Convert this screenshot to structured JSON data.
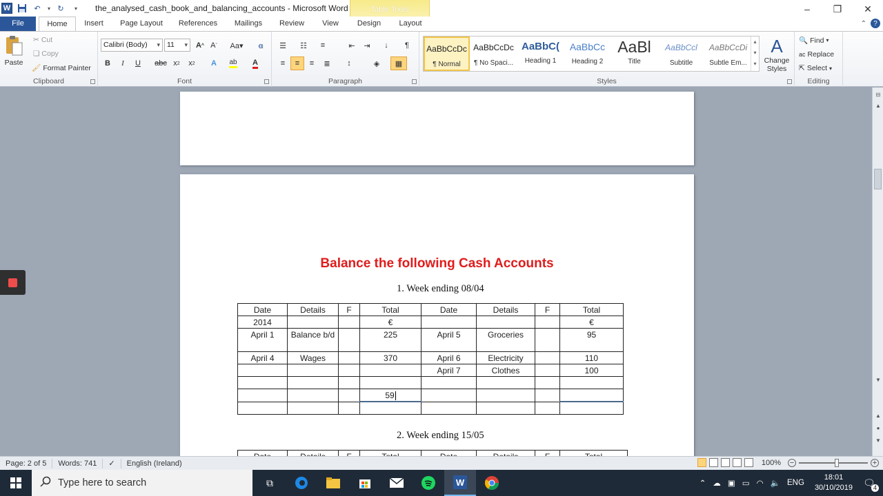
{
  "window": {
    "title": "the_analysed_cash_book_and_balancing_accounts  -  Microsoft Word",
    "context_tab_group": "Table Tools"
  },
  "tabs": [
    "File",
    "Home",
    "Insert",
    "Page Layout",
    "References",
    "Mailings",
    "Review",
    "View",
    "Design",
    "Layout"
  ],
  "ribbon": {
    "clipboard": {
      "label": "Clipboard",
      "paste": "Paste",
      "cut": "Cut",
      "copy": "Copy",
      "format_painter": "Format Painter"
    },
    "font": {
      "label": "Font",
      "font_name": "Calibri (Body)",
      "font_size": "11"
    },
    "paragraph": {
      "label": "Paragraph"
    },
    "styles": {
      "label": "Styles",
      "items": [
        {
          "preview": "AaBbCcDc",
          "name": "¶ Normal"
        },
        {
          "preview": "AaBbCcDc",
          "name": "¶ No Spaci..."
        },
        {
          "preview": "AaBbC(",
          "name": "Heading 1"
        },
        {
          "preview": "AaBbCc",
          "name": "Heading 2"
        },
        {
          "preview": "AaBl",
          "name": "Title"
        },
        {
          "preview": "AaBbCcl",
          "name": "Subtitle"
        },
        {
          "preview": "AaBbCcDi",
          "name": "Subtle Em..."
        }
      ],
      "change_styles": "Change Styles"
    },
    "editing": {
      "label": "Editing",
      "find": "Find",
      "replace": "Replace",
      "select": "Select"
    }
  },
  "document": {
    "heading": "Balance the following Cash Accounts",
    "week1": "1.   Week ending 08/04",
    "week2": "2.   Week ending 15/05",
    "table_headers": [
      "Date",
      "Details",
      "F",
      "Total",
      "Date",
      "Details",
      "F",
      "Total"
    ],
    "rows": [
      [
        "2014",
        "",
        "",
        "€",
        "",
        "",
        "",
        "€"
      ],
      [
        "April 1",
        "Balance b/d",
        "",
        "225",
        "April 5",
        "Groceries",
        "",
        "95"
      ],
      [
        "April 4",
        "Wages",
        "",
        "370",
        "April 6",
        "Electricity",
        "",
        "110"
      ],
      [
        "",
        "",
        "",
        "",
        "April 7",
        "Clothes",
        "",
        "100"
      ],
      [
        "",
        "",
        "",
        "",
        "",
        "",
        "",
        ""
      ],
      [
        "",
        "",
        "",
        "59",
        "",
        "",
        "",
        ""
      ],
      [
        "",
        "",
        "",
        "",
        "",
        "",
        "",
        ""
      ]
    ]
  },
  "statusbar": {
    "page": "Page: 2 of 5",
    "words": "Words: 741",
    "language": "English (Ireland)",
    "zoom": "100%"
  },
  "taskbar": {
    "search_placeholder": "Type here to search",
    "language": "ENG",
    "time": "18:01",
    "date": "30/10/2019",
    "notifications": "4"
  },
  "colors": {
    "accent": "#2b579a",
    "heading_red": "#e01c1c",
    "taskbar": "#1f2a38"
  }
}
